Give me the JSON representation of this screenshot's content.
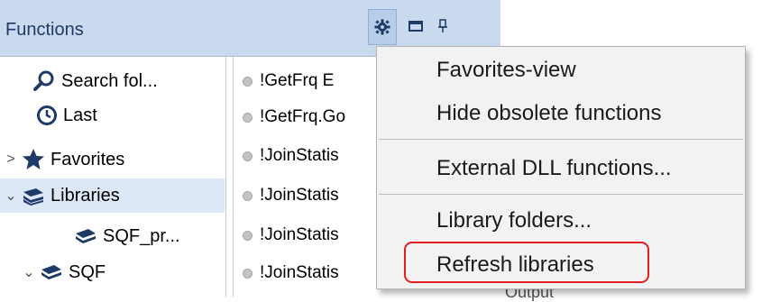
{
  "panel": {
    "title": "Functions",
    "buttons": [
      "gear-icon",
      "window-icon",
      "pin-icon"
    ]
  },
  "tree": {
    "items": [
      {
        "label": "Search fol...",
        "icon": "search-icon"
      },
      {
        "label": "Last",
        "icon": "clock-icon"
      },
      {
        "label": "Favorites",
        "icon": "star-icon",
        "caret": ">"
      },
      {
        "label": "Libraries",
        "icon": "books-icon",
        "caret": "⌄",
        "selected": true
      },
      {
        "label": "SQF_pr...",
        "icon": "book-icon"
      },
      {
        "label": "SQF",
        "icon": "book-icon",
        "caret": "⌄"
      }
    ]
  },
  "list": {
    "items": [
      "!GetFrq   E",
      "!GetFrq.Go",
      "!JoinStatis",
      "!JoinStatis",
      "!JoinStatis",
      "!JoinStatis"
    ]
  },
  "menu": {
    "items": [
      "Favorites-view",
      "Hide obsolete functions",
      "External DLL functions...",
      "Library folders...",
      "Refresh libraries"
    ],
    "highlighted": "Refresh libraries",
    "highlight_color": "#e11d1d"
  },
  "background_peek": "Output"
}
